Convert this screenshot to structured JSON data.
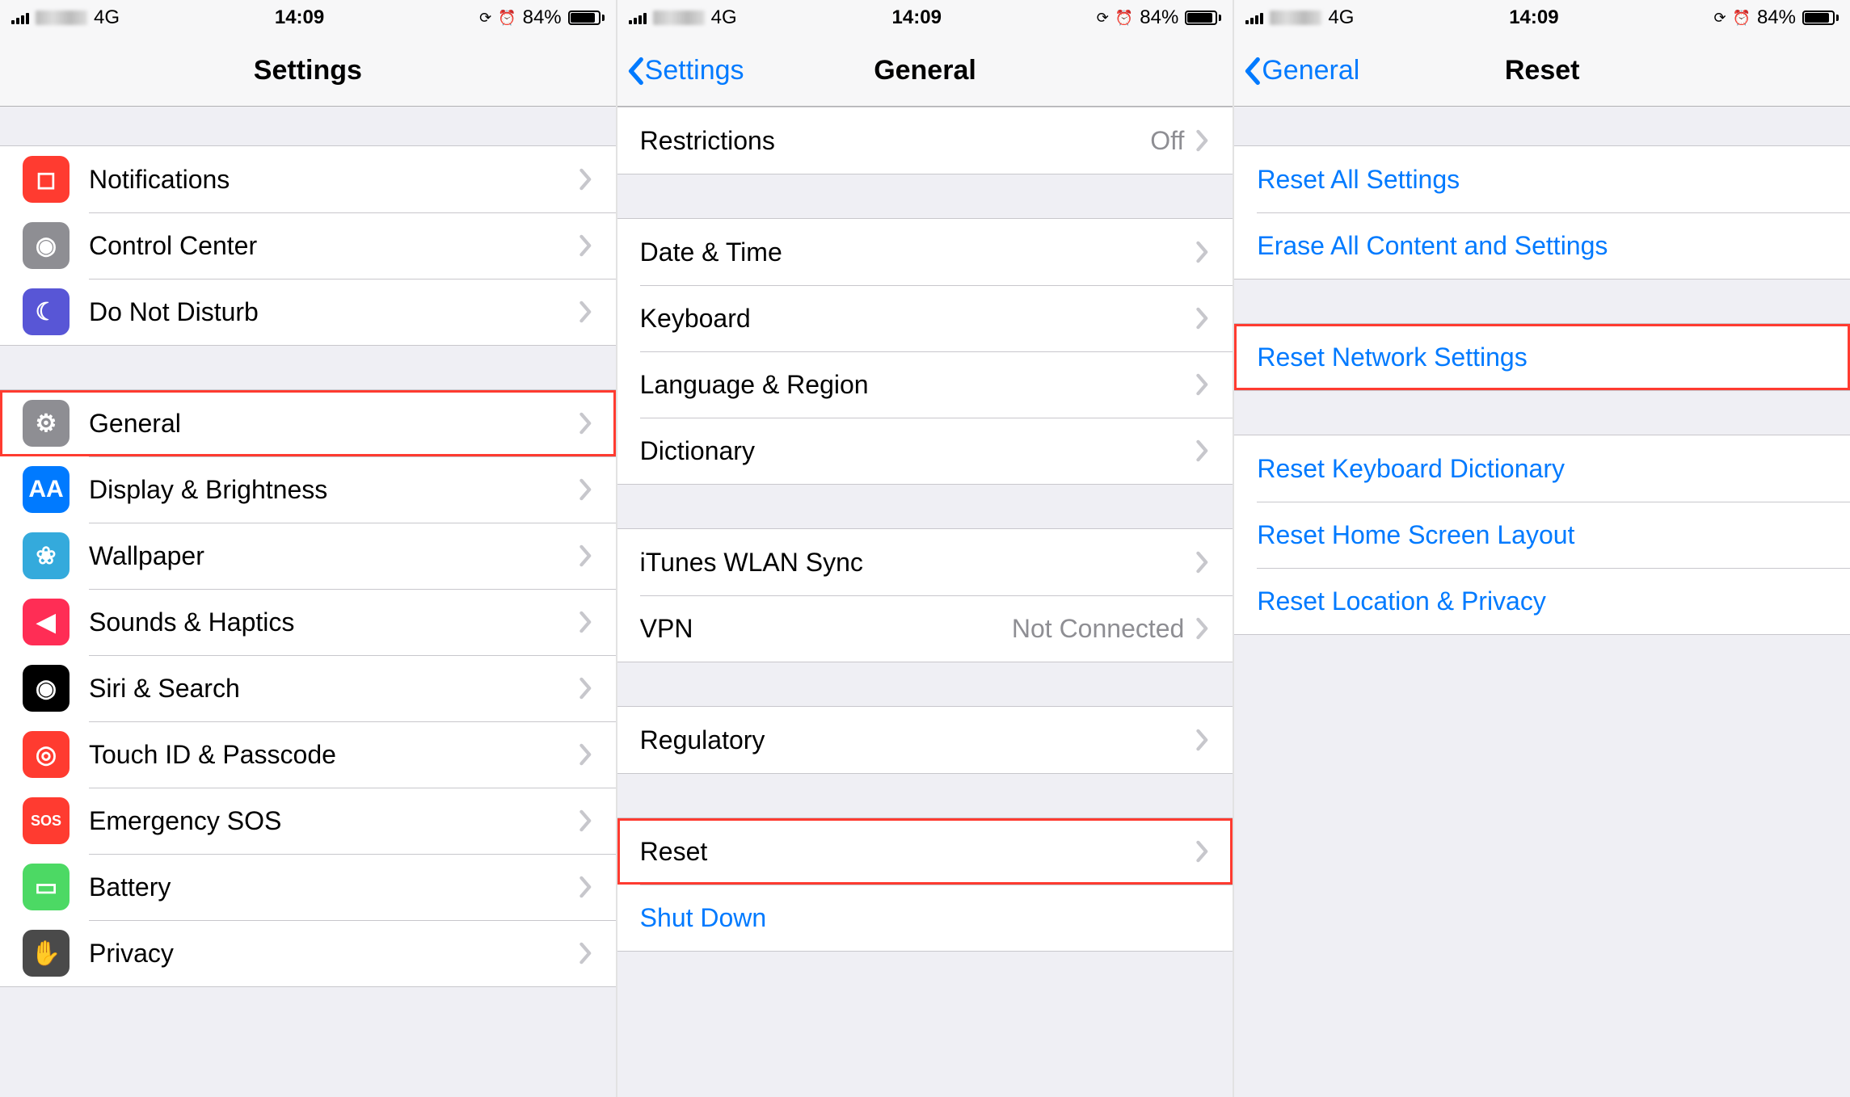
{
  "status_bar": {
    "network_type": "4G",
    "time": "14:09",
    "battery_percent": "84%"
  },
  "panel1": {
    "title": "Settings",
    "groups": [
      [
        {
          "id": "notifications",
          "label": "Notifications",
          "icon": "notifications-icon"
        },
        {
          "id": "control-center",
          "label": "Control Center",
          "icon": "control-center-icon"
        },
        {
          "id": "do-not-disturb",
          "label": "Do Not Disturb",
          "icon": "moon-icon"
        }
      ],
      [
        {
          "id": "general",
          "label": "General",
          "icon": "gear-icon",
          "highlight": true
        },
        {
          "id": "display-brightness",
          "label": "Display & Brightness",
          "icon": "text-size-icon"
        },
        {
          "id": "wallpaper",
          "label": "Wallpaper",
          "icon": "flower-icon"
        },
        {
          "id": "sounds-haptics",
          "label": "Sounds & Haptics",
          "icon": "speaker-icon"
        },
        {
          "id": "siri-search",
          "label": "Siri & Search",
          "icon": "siri-icon"
        },
        {
          "id": "touch-id-passcode",
          "label": "Touch ID & Passcode",
          "icon": "fingerprint-icon"
        },
        {
          "id": "emergency-sos",
          "label": "Emergency SOS",
          "icon": "sos-icon"
        },
        {
          "id": "battery",
          "label": "Battery",
          "icon": "battery-icon"
        },
        {
          "id": "privacy",
          "label": "Privacy",
          "icon": "hand-icon"
        }
      ]
    ]
  },
  "panel2": {
    "back": "Settings",
    "title": "General",
    "groups": [
      [
        {
          "id": "restrictions",
          "label": "Restrictions",
          "value": "Off"
        }
      ],
      [
        {
          "id": "date-time",
          "label": "Date & Time"
        },
        {
          "id": "keyboard",
          "label": "Keyboard"
        },
        {
          "id": "language-region",
          "label": "Language & Region"
        },
        {
          "id": "dictionary",
          "label": "Dictionary"
        }
      ],
      [
        {
          "id": "itunes-wlan-sync",
          "label": "iTunes WLAN Sync"
        },
        {
          "id": "vpn",
          "label": "VPN",
          "value": "Not Connected"
        }
      ],
      [
        {
          "id": "regulatory",
          "label": "Regulatory"
        }
      ],
      [
        {
          "id": "reset",
          "label": "Reset",
          "highlight": true
        },
        {
          "id": "shut-down",
          "label": "Shut Down",
          "link": true,
          "no_chevron": true
        }
      ]
    ]
  },
  "panel3": {
    "back": "General",
    "title": "Reset",
    "groups": [
      [
        {
          "id": "reset-all-settings",
          "label": "Reset All Settings"
        },
        {
          "id": "erase-all-content",
          "label": "Erase All Content and Settings"
        }
      ],
      [
        {
          "id": "reset-network-settings",
          "label": "Reset Network Settings",
          "highlight": true
        }
      ],
      [
        {
          "id": "reset-keyboard-dictionary",
          "label": "Reset Keyboard Dictionary"
        },
        {
          "id": "reset-home-screen-layout",
          "label": "Reset Home Screen Layout"
        },
        {
          "id": "reset-location-privacy",
          "label": "Reset Location & Privacy"
        }
      ]
    ]
  },
  "icon_colors": {
    "notifications-icon": "bg-red",
    "control-center-icon": "bg-gray",
    "moon-icon": "bg-indigo",
    "gear-icon": "bg-gray",
    "text-size-icon": "bg-blue",
    "flower-icon": "bg-teal",
    "speaker-icon": "bg-pink",
    "siri-icon": "bg-black",
    "fingerprint-icon": "bg-red",
    "sos-icon": "bg-red",
    "battery-icon": "bg-green",
    "hand-icon": "bg-darkgray"
  },
  "icon_glyphs": {
    "notifications-icon": "◻",
    "control-center-icon": "◉",
    "moon-icon": "☾",
    "gear-icon": "⚙",
    "text-size-icon": "AA",
    "flower-icon": "❀",
    "speaker-icon": "◀",
    "siri-icon": "◉",
    "fingerprint-icon": "◎",
    "sos-icon": "SOS",
    "battery-icon": "▭",
    "hand-icon": "✋"
  }
}
